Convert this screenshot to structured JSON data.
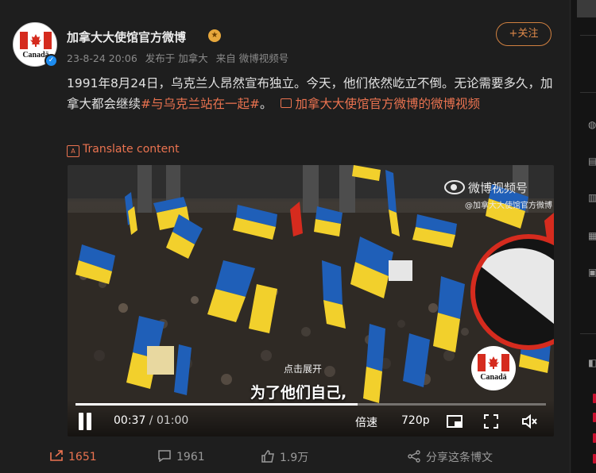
{
  "post": {
    "username": "加拿大大使馆官方微博",
    "avatar_text": "Canadä",
    "meta": {
      "date": "23-8-24 20:06",
      "posted_from": "发布于 加拿大",
      "source": "来自 微博视频号"
    },
    "follow_label": "+关注",
    "text_before": "1991年8月24日，乌克兰人昂然宣布独立。今天，他们依然屹立不倒。无论需要多久，加拿大都会继续",
    "hashtag": "#与乌克兰站在一起#",
    "text_after": "。",
    "video_link": "加拿大大使馆官方微博的微博视频",
    "translate_label": "Translate content"
  },
  "video": {
    "watermark": "微博视频号",
    "watermark_sub": "@加拿大大使馆官方微博",
    "badge_text": "Canadä",
    "expand_hint": "点击展开",
    "subtitle": "为了他们自己,",
    "current_time": "00:37",
    "total_time": "01:00",
    "time_sep": " / ",
    "speed_label": "倍速",
    "quality_label": "720p",
    "progress": 0.6
  },
  "actions": {
    "share_count": "1651",
    "comment_count": "1961",
    "like_count": "1.9万",
    "share_to_label": "分享这条博文"
  },
  "colors": {
    "accent": "#eb7350",
    "background": "#1e1e1e",
    "flag_blue": "#1f5fb8",
    "flag_yellow": "#f2d02c",
    "canada_red": "#d52b1e"
  }
}
